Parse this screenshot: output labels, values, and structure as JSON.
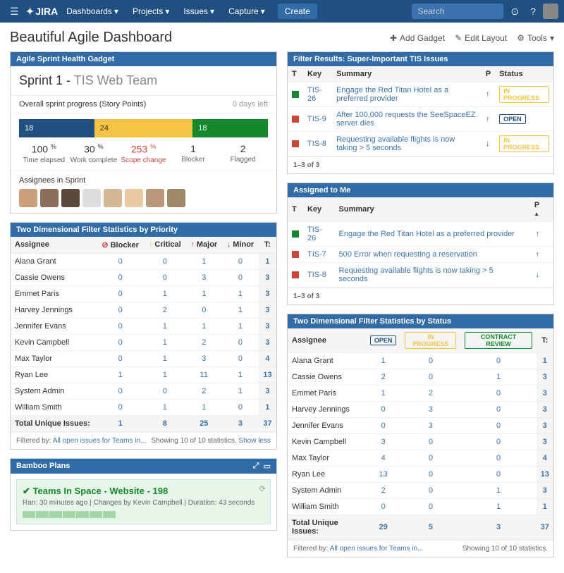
{
  "nav": {
    "brand": "JIRA",
    "items": [
      "Dashboards",
      "Projects",
      "Issues",
      "Capture"
    ],
    "create": "Create",
    "search_placeholder": "Search"
  },
  "page": {
    "title": "Beautiful Agile Dashboard",
    "addGadget": "Add Gadget",
    "editLayout": "Edit Layout",
    "tools": "Tools"
  },
  "sprint": {
    "header": "Agile Sprint Health Gadget",
    "name": "Sprint 1",
    "team": "TIS Web Team",
    "progressLabel": "Overall sprint progress (Story Points)",
    "daysLeft": "0 days left",
    "bar": {
      "blue": "18",
      "yellow": "24",
      "green": "18"
    },
    "metrics": [
      {
        "v": "100",
        "unit": "%",
        "l": "Time elapsed"
      },
      {
        "v": "30",
        "unit": "%",
        "l": "Work complete"
      },
      {
        "v": "253",
        "unit": "%",
        "l": "Scope change",
        "red": true
      },
      {
        "v": "1",
        "unit": "",
        "l": "Blocker"
      },
      {
        "v": "2",
        "unit": "",
        "l": "Flagged"
      }
    ],
    "assigneesLabel": "Assignees in Sprint"
  },
  "priorityStats": {
    "header": "Two Dimensional Filter Statistics by Priority",
    "cols": [
      "Assignee",
      "Blocker",
      "Critical",
      "Major",
      "Minor",
      "T:"
    ],
    "rows": [
      {
        "n": "Alana Grant",
        "v": [
          0,
          0,
          1,
          0
        ],
        "t": 1
      },
      {
        "n": "Cassie Owens",
        "v": [
          0,
          0,
          3,
          0
        ],
        "t": 3
      },
      {
        "n": "Emmet Paris",
        "v": [
          0,
          1,
          1,
          1
        ],
        "t": 3
      },
      {
        "n": "Harvey Jennings",
        "v": [
          0,
          2,
          0,
          1
        ],
        "t": 3
      },
      {
        "n": "Jennifer Evans",
        "v": [
          0,
          1,
          1,
          1
        ],
        "t": 3
      },
      {
        "n": "Kevin Campbell",
        "v": [
          0,
          1,
          2,
          0
        ],
        "t": 3
      },
      {
        "n": "Max Taylor",
        "v": [
          0,
          1,
          3,
          0
        ],
        "t": 4
      },
      {
        "n": "Ryan Lee",
        "v": [
          1,
          1,
          11,
          1
        ],
        "t": 13
      },
      {
        "n": "System Admin",
        "v": [
          0,
          0,
          2,
          1
        ],
        "t": 3
      },
      {
        "n": "William Smith",
        "v": [
          0,
          1,
          1,
          0
        ],
        "t": 1
      }
    ],
    "totalLabel": "Total Unique Issues:",
    "totals": [
      1,
      8,
      25,
      3,
      37
    ],
    "filteredBy": "Filtered by:",
    "filterLink": "All open issues for Teams in...",
    "showing": "Showing 10 of 10 statistics.",
    "showLess": "Show less"
  },
  "filterResults": {
    "header": "Filter Results: Super-Important TIS Issues",
    "cols": [
      "T",
      "Key",
      "Summary",
      "P",
      "Status"
    ],
    "rows": [
      {
        "type": "story",
        "key": "TIS-26",
        "sum": "Engage the Red Titan Hotel as a preferred provider",
        "p": "up",
        "status": "IN PROGRESS"
      },
      {
        "type": "bug",
        "key": "TIS-9",
        "sum": "After 100,000 requests the SeeSpaceEZ server dies",
        "p": "up",
        "status": "OPEN"
      },
      {
        "type": "bug",
        "key": "TIS-8",
        "sum": "Requesting available flights is now taking > 5 seconds",
        "p": "down",
        "status": "IN PROGRESS"
      }
    ],
    "paging": "1–3 of 3"
  },
  "assignedToMe": {
    "header": "Assigned to Me",
    "cols": [
      "T",
      "Key",
      "Summary",
      "P"
    ],
    "rows": [
      {
        "type": "story",
        "key": "TIS-26",
        "sum": "Engage the Red Titan Hotel as a preferred provider",
        "p": "up"
      },
      {
        "type": "bug",
        "key": "TIS-7",
        "sum": "500 Error when requesting a reservation",
        "p": "up"
      },
      {
        "type": "bug",
        "key": "TIS-8",
        "sum": "Requesting available flights is now taking > 5 seconds",
        "p": "down"
      }
    ],
    "paging": "1–3 of 3"
  },
  "statusStats": {
    "header": "Two Dimensional Filter Statistics by Status",
    "cols": [
      "Assignee",
      "OPEN",
      "IN PROGRESS",
      "CONTRACT REVIEW",
      "T:"
    ],
    "rows": [
      {
        "n": "Alana Grant",
        "v": [
          1,
          0,
          0
        ],
        "t": 1
      },
      {
        "n": "Cassie Owens",
        "v": [
          2,
          0,
          1
        ],
        "t": 3
      },
      {
        "n": "Emmet Paris",
        "v": [
          1,
          2,
          0
        ],
        "t": 3
      },
      {
        "n": "Harvey Jennings",
        "v": [
          0,
          3,
          0
        ],
        "t": 3
      },
      {
        "n": "Jennifer Evans",
        "v": [
          0,
          3,
          0
        ],
        "t": 3
      },
      {
        "n": "Kevin Campbell",
        "v": [
          3,
          0,
          0
        ],
        "t": 3
      },
      {
        "n": "Max Taylor",
        "v": [
          4,
          0,
          0
        ],
        "t": 4
      },
      {
        "n": "Ryan Lee",
        "v": [
          13,
          0,
          0
        ],
        "t": 13
      },
      {
        "n": "System Admin",
        "v": [
          2,
          0,
          1
        ],
        "t": 3
      },
      {
        "n": "William Smith",
        "v": [
          0,
          0,
          1
        ],
        "t": 1
      }
    ],
    "totalLabel": "Total Unique Issues:",
    "totals": [
      29,
      5,
      3,
      37
    ],
    "filteredBy": "Filtered by:",
    "filterLink": "All open issues for Teams in...",
    "showing": "Showing 10 of 10 statistics."
  },
  "bamboo": {
    "header": "Bamboo Plans",
    "title": "Teams In Space - Website - 198",
    "ran": "Ran: 30 minutes ago",
    "changes": "Changes by Kevin Campbell",
    "duration": "Duration: 43 seconds"
  }
}
